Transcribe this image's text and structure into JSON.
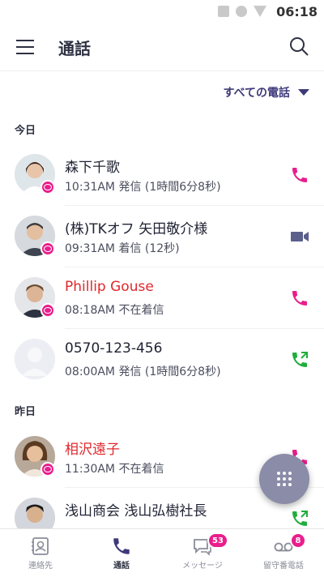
{
  "status_bar": {
    "time": "06:18"
  },
  "app_bar": {
    "title": "通話"
  },
  "filter": {
    "label": "すべての電話"
  },
  "sections": {
    "today": "今日",
    "yesterday": "昨日"
  },
  "calls": [
    {
      "name": "森下千歌",
      "detail": "10:31AM 発信 (1時間6分8秒)",
      "missed": false,
      "call_icon": "phone-icon",
      "has_badge": true
    },
    {
      "name": "(株)TKオフ 矢田敬介様",
      "detail": "09:31AM 着信 (12秒)",
      "missed": false,
      "call_icon": "video-icon",
      "has_badge": true
    },
    {
      "name": "Phillip Gouse",
      "detail": "08:18AM 不在着信",
      "missed": true,
      "call_icon": "phone-icon",
      "has_badge": true
    },
    {
      "name": "0570-123-456",
      "detail": "08:00AM 発信 (1時間6分8秒)",
      "missed": false,
      "call_icon": "phone-outgoing-icon",
      "has_badge": false
    },
    {
      "name": "相沢遠子",
      "detail": "11:30AM 不在着信",
      "missed": true,
      "call_icon": "phone-icon",
      "has_badge": true
    },
    {
      "name": "浅山商会 浅山弘樹社長",
      "detail": "",
      "missed": false,
      "call_icon": "phone-outgoing-icon",
      "has_badge": false
    }
  ],
  "bottom_nav": {
    "contacts": "連絡先",
    "calls": "通話",
    "messages": "メッセージ",
    "messages_badge": "53",
    "voicemail": "留守番電話",
    "voicemail_badge": "8"
  },
  "colors": {
    "accent_pink": "#e91e8c",
    "missed_red": "#e0282c",
    "brand_navy": "#3d3a7a",
    "green": "#1fae3b",
    "fab": "#8a8ca8"
  }
}
